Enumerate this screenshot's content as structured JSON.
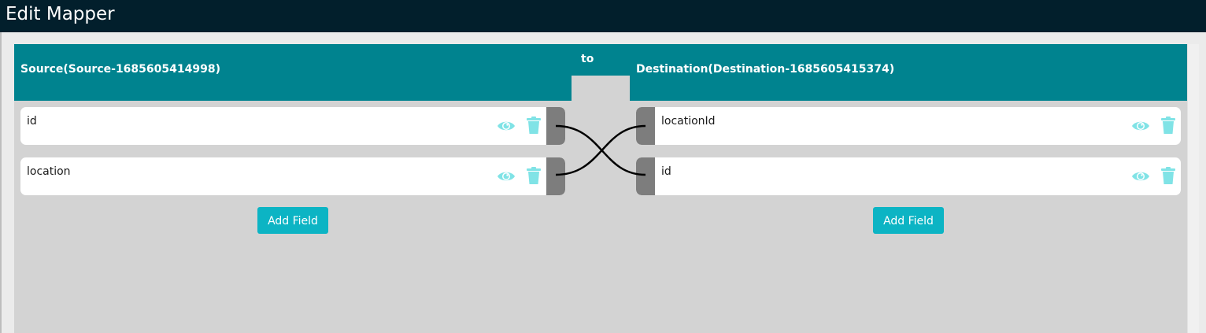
{
  "window": {
    "title": "Edit Mapper"
  },
  "source": {
    "title": "Source(Source-1685605414998)",
    "fields": [
      {
        "label": "id"
      },
      {
        "label": "location"
      }
    ],
    "add_field_label": "Add Field"
  },
  "connector": {
    "label": "to"
  },
  "destination": {
    "title": "Destination(Destination-1685605415374)",
    "fields": [
      {
        "label": "locationId"
      },
      {
        "label": "id"
      }
    ],
    "add_field_label": "Add Field"
  },
  "mappings": [
    {
      "from": "id",
      "to": "id"
    },
    {
      "from": "location",
      "to": "locationId"
    }
  ],
  "icons": {
    "view": "eye-icon",
    "delete": "trash-icon"
  },
  "colors": {
    "titlebar": "#021f2c",
    "header": "#00838f",
    "panel": "#d3d3d3",
    "button": "#0cb4c4",
    "icon": "#80e3e6",
    "handle": "#7d7d7d"
  }
}
